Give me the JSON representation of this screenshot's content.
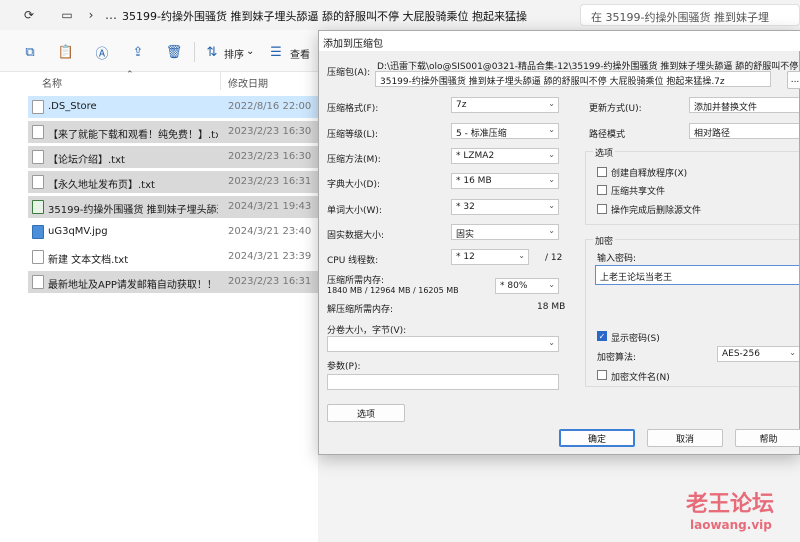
{
  "address": {
    "breadcrumb": "35199-约操外围骚货  推到妹子埋头舔逼  舔的舒服叫不停  大屁股骑乘位 抱起来猛操",
    "search_placeholder": "在 35199-约操外围骚货  推到妹子埋"
  },
  "toolbar": {
    "sort_label": "排序",
    "view_label": "查看"
  },
  "filelist": {
    "col_name": "名称",
    "col_date": "修改日期",
    "files": [
      {
        "name": ".DS_Store",
        "date": "2022/8/16 22:00"
      },
      {
        "name": "【来了就能下载和观看！纯免费！】.txt",
        "date": "2023/2/23 16:30"
      },
      {
        "name": "【论坛介绍】.txt",
        "date": "2023/2/23 16:30"
      },
      {
        "name": "【永久地址发布页】.txt",
        "date": "2023/2/23 16:31"
      },
      {
        "name": "35199-约操外围骚货  推到妹子埋头舔逼...",
        "date": "2024/3/21 19:43"
      },
      {
        "name": "uG3qMV.jpg",
        "date": "2024/3/21 23:40"
      },
      {
        "name": "新建 文本文档.txt",
        "date": "2024/3/21 23:39"
      },
      {
        "name": "最新地址及APP请发邮箱自动获取！！！...",
        "date": "2023/2/23 16:31"
      }
    ]
  },
  "dialog": {
    "title": "添加到压缩包",
    "archive_label": "压缩包(A):",
    "archive_path_line1": "D:\\迅雷下载\\olo@SIS001@0321-精品合集-12\\35199-约操外围骚货  推到妹子埋头舔逼  舔的舒服叫不停  大屁股骑",
    "archive_path_line2": "35199-约操外围骚货  推到妹子埋头舔逼  舔的舒服叫不停  大屁股骑乘位 抱起来猛操.7z",
    "browse_label": "...",
    "format_label": "压缩格式(F):",
    "format_value": "7z",
    "level_label": "压缩等级(L):",
    "level_value": "5 - 标准压缩",
    "method_label": "压缩方法(M):",
    "method_value": "* LZMA2",
    "dict_label": "字典大小(D):",
    "dict_value": "* 16 MB",
    "word_label": "单词大小(W):",
    "word_value": "* 32",
    "solid_label": "固实数据大小:",
    "solid_value": "固实",
    "cpu_label": "CPU 线程数:",
    "cpu_value": "* 12",
    "cpu_max": "/ 12",
    "mem_comp_label": "压缩所需内存:",
    "mem_comp_detail": "1840 MB / 12964 MB / 16205 MB",
    "mem_comp_value": "* 80%",
    "mem_decomp_label": "解压缩所需内存:",
    "mem_decomp_value": "18 MB",
    "split_label": "分卷大小，字节(V):",
    "split_value": "",
    "params_label": "参数(P):",
    "params_value": "",
    "options_button": "选项",
    "update_label": "更新方式(U):",
    "update_value": "添加并替换文件",
    "path_mode_label": "路径模式",
    "path_mode_value": "相对路径",
    "options_group": "选项",
    "opt_sfx": "创建自释放程序(X)",
    "opt_shared": "压缩共享文件",
    "opt_delete": "操作完成后删除源文件",
    "encrypt_group": "加密",
    "password_label": "输入密码:",
    "password_value": "上老王论坛当老王",
    "show_password": "显示密码(S)",
    "enc_method_label": "加密算法:",
    "enc_method_value": "AES-256",
    "enc_names": "加密文件名(N)",
    "ok_button": "确定",
    "cancel_button": "取消",
    "help_button": "帮助"
  },
  "watermark": {
    "big": "老王论坛",
    "small": "laowang.vip"
  }
}
